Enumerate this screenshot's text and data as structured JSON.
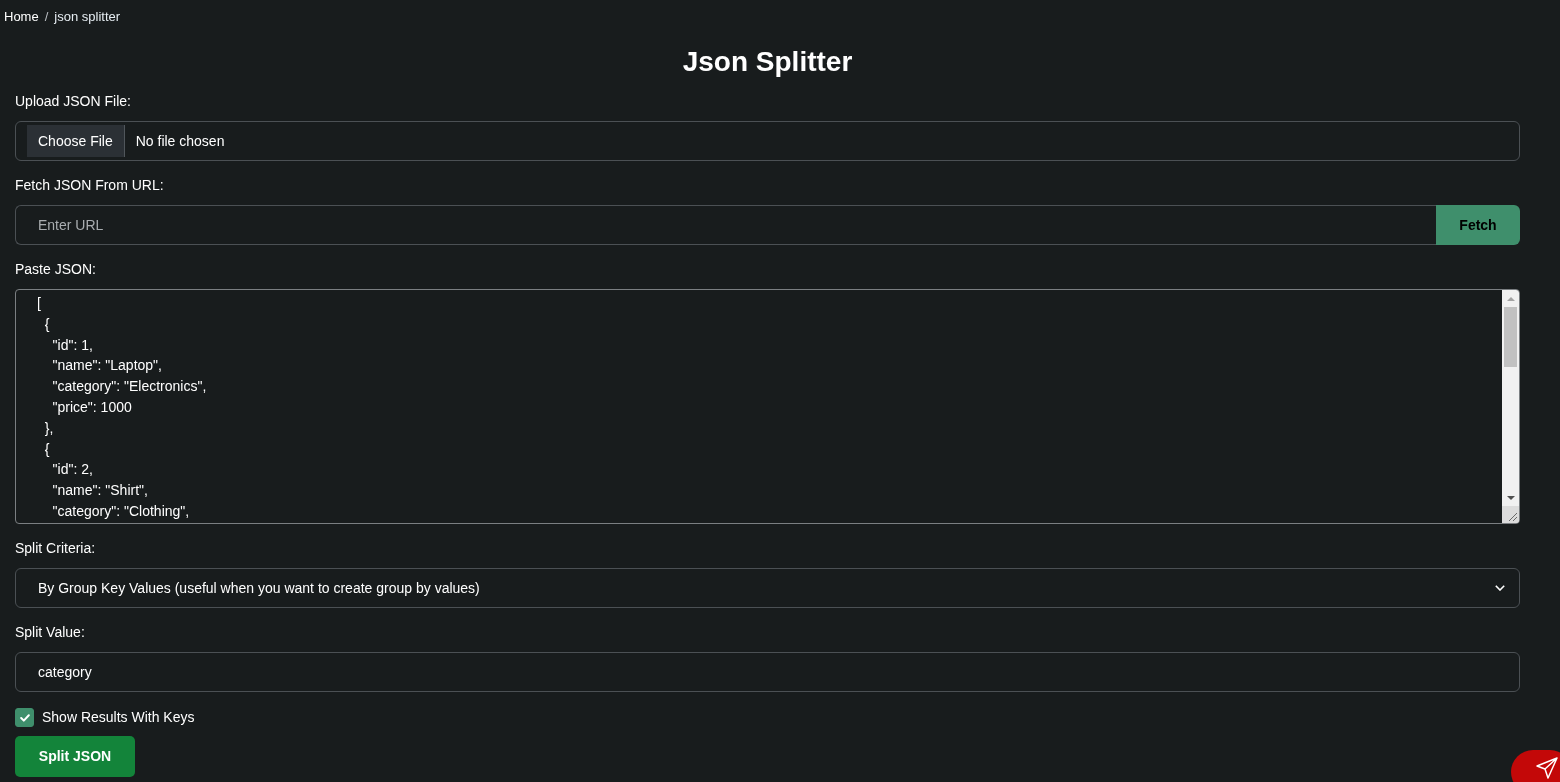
{
  "breadcrumb": {
    "separator": "/",
    "items": [
      {
        "label": "Home",
        "kind": "link"
      },
      {
        "label": "json splitter",
        "kind": "current"
      }
    ]
  },
  "title": "Json Splitter",
  "upload": {
    "label": "Upload JSON File:",
    "button": "Choose File",
    "status": "No file chosen"
  },
  "fetch": {
    "label": "Fetch JSON From URL:",
    "placeholder": "Enter URL",
    "button": "Fetch"
  },
  "paste": {
    "label": "Paste JSON:",
    "lines": [
      "[",
      "  {",
      "    \"id\": 1,",
      "    \"name\": \"Laptop\",",
      "    \"category\": \"Electronics\",",
      "    \"price\": 1000",
      "  },",
      "  {",
      "    \"id\": 2,",
      "    \"name\": \"Shirt\",",
      "    \"category\": \"Clothing\","
    ]
  },
  "criteria": {
    "label": "Split Criteria:",
    "value": "By Group Key Values (useful when you want to create group by values)"
  },
  "split_value": {
    "label": "Split Value:",
    "value": "category"
  },
  "show_keys": {
    "label": "Show Results With Keys",
    "checked": true
  },
  "submit": {
    "label": "Split JSON"
  }
}
